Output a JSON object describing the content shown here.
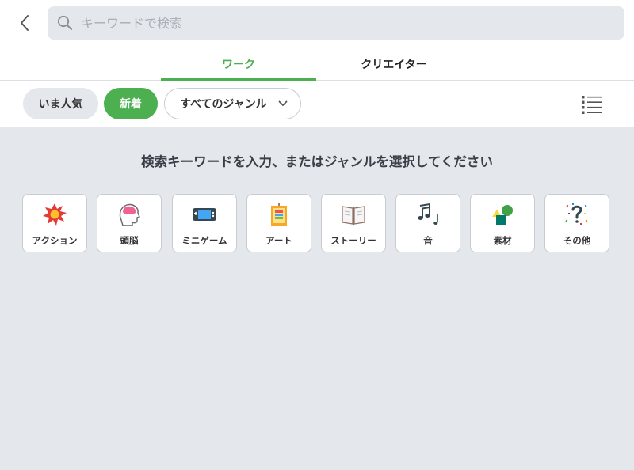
{
  "search": {
    "placeholder": "キーワードで検索",
    "value": ""
  },
  "tabs": [
    {
      "label": "ワーク",
      "active": true
    },
    {
      "label": "クリエイター",
      "active": false
    }
  ],
  "filters": {
    "popular_label": "いま人気",
    "new_label": "新着",
    "genre_select_label": "すべてのジャンル"
  },
  "prompt": "検索キーワードを入力、またはジャンルを選択してください",
  "genres": [
    {
      "label": "アクション",
      "icon": "explosion-icon"
    },
    {
      "label": "頭脳",
      "icon": "brain-head-icon"
    },
    {
      "label": "ミニゲーム",
      "icon": "handheld-console-icon"
    },
    {
      "label": "アート",
      "icon": "canvas-icon"
    },
    {
      "label": "ストーリー",
      "icon": "open-book-icon"
    },
    {
      "label": "音",
      "icon": "music-notes-icon"
    },
    {
      "label": "素材",
      "icon": "shapes-icon"
    },
    {
      "label": "その他",
      "icon": "question-confetti-icon"
    }
  ],
  "colors": {
    "accent": "#4caf50",
    "background": "#e4e7ec",
    "surface": "#ffffff"
  }
}
